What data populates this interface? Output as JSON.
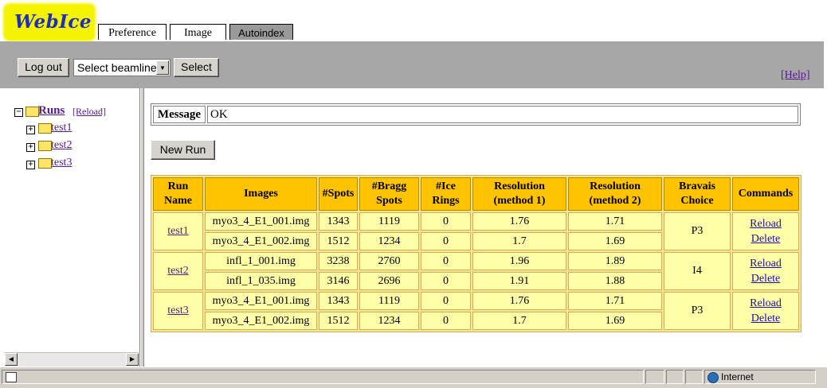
{
  "app": {
    "logo_text": "WebIce"
  },
  "tabs": [
    {
      "label": "Preference",
      "active": false
    },
    {
      "label": "Image",
      "active": false
    },
    {
      "label": "Autoindex",
      "active": true
    }
  ],
  "toolbar": {
    "logout_label": "Log out",
    "beamline_select": "Select beamline",
    "select_label": "Select",
    "help_label": "[Help]"
  },
  "tree": {
    "root_label": "Runs",
    "reload_label": "[Reload]",
    "items": [
      "test1",
      "test2",
      "test3"
    ]
  },
  "message": {
    "label": "Message",
    "value": "OK"
  },
  "new_run_label": "New Run",
  "table": {
    "headers": {
      "run_name": "Run Name",
      "images": "Images",
      "spots": "#Spots",
      "bragg": "#Bragg Spots",
      "ice": "#Ice Rings",
      "res1": "Resolution (method 1)",
      "res2": "Resolution (method 2)",
      "bravais": "Bravais Choice",
      "commands": "Commands"
    },
    "runs": [
      {
        "name": "test1",
        "bravais": "P3",
        "reload": "Reload",
        "delete": "Delete",
        "rows": [
          {
            "image": "myo3_4_E1_001.img",
            "spots": "1343",
            "bragg": "1119",
            "ice": "0",
            "res1": "1.76",
            "res2": "1.71"
          },
          {
            "image": "myo3_4_E1_002.img",
            "spots": "1512",
            "bragg": "1234",
            "ice": "0",
            "res1": "1.7",
            "res2": "1.69"
          }
        ]
      },
      {
        "name": "test2",
        "bravais": "I4",
        "reload": "Reload",
        "delete": "Delete",
        "rows": [
          {
            "image": "infl_1_001.img",
            "spots": "3238",
            "bragg": "2760",
            "ice": "0",
            "res1": "1.96",
            "res2": "1.89"
          },
          {
            "image": "infl_1_035.img",
            "spots": "3146",
            "bragg": "2696",
            "ice": "0",
            "res1": "1.91",
            "res2": "1.88"
          }
        ]
      },
      {
        "name": "test3",
        "bravais": "P3",
        "reload": "Reload",
        "delete": "Delete",
        "rows": [
          {
            "image": "myo3_4_E1_001.img",
            "spots": "1343",
            "bragg": "1119",
            "ice": "0",
            "res1": "1.76",
            "res2": "1.71"
          },
          {
            "image": "myo3_4_E1_002.img",
            "spots": "1512",
            "bragg": "1234",
            "ice": "0",
            "res1": "1.7",
            "res2": "1.69"
          }
        ]
      }
    ]
  },
  "statusbar": {
    "zone_label": "Internet"
  }
}
